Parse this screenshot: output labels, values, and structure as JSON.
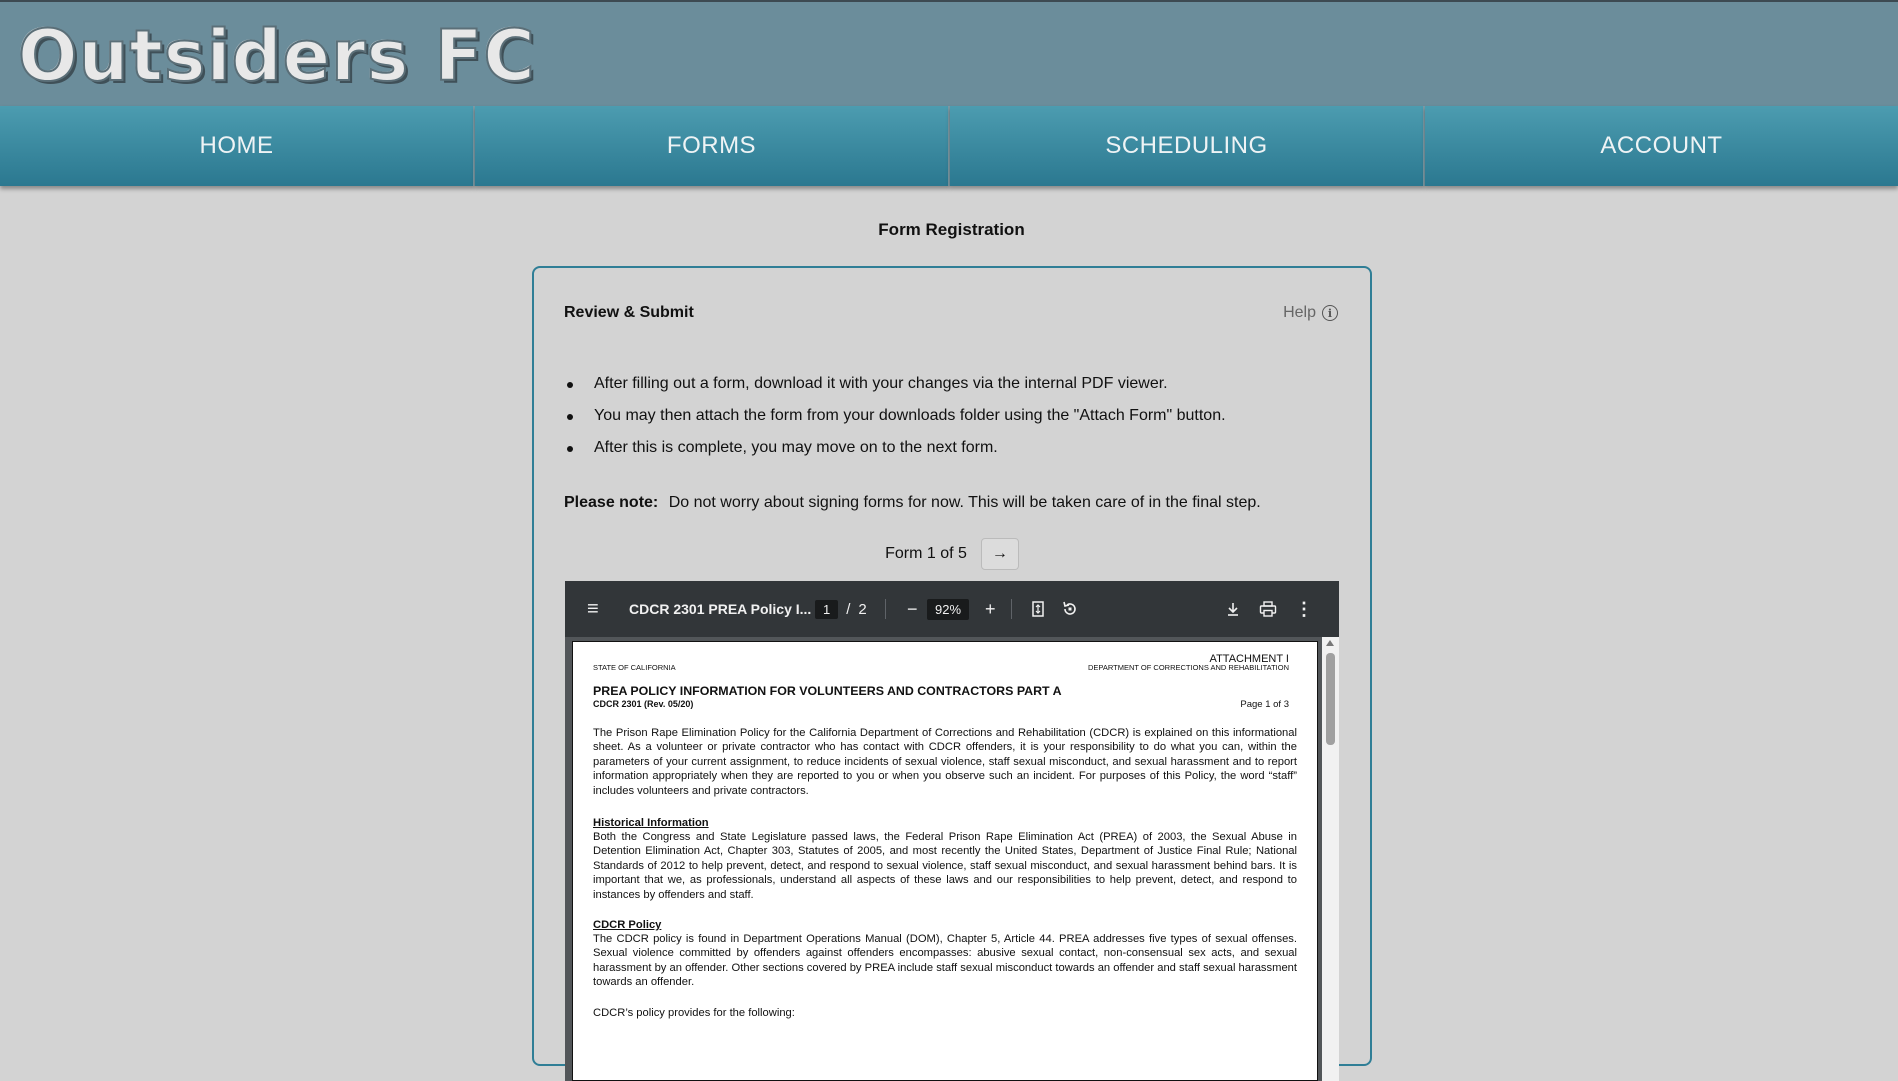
{
  "header": {
    "logo_text": "Outsiders FC",
    "background": "#6b8d9b"
  },
  "nav": {
    "items": [
      {
        "label": "HOME"
      },
      {
        "label": "FORMS"
      },
      {
        "label": "SCHEDULING"
      },
      {
        "label": "ACCOUNT"
      }
    ],
    "accent": "#2b7890"
  },
  "page": {
    "title": "Form Registration"
  },
  "card": {
    "title": "Review & Submit",
    "help_label": "Help",
    "help_icon": "info-icon",
    "bullets": [
      "After filling out a form, download it with your changes via the internal PDF viewer.",
      "You may then attach the form from your downloads folder using the \"Attach Form\" button.",
      "After this is complete, you may move on to the next form."
    ],
    "note_label": "Please note:",
    "note_text": "Do not worry about signing forms for now. This will be taken care of in the final step.",
    "pager_text": "Form 1 of 5",
    "next_icon": "→"
  },
  "pdf_viewer": {
    "menu_icon": "≡",
    "filename": "CDCR 2301 PREA Policy I...",
    "current_page": "1",
    "page_separator": "/",
    "total_pages": "2",
    "zoom_out_icon": "−",
    "zoom": "92%",
    "zoom_in_icon": "+",
    "download_icon": "download-icon",
    "print_icon": "print-icon",
    "more_icon": "⋮",
    "document": {
      "attachment": "ATTACHMENT I",
      "state": "STATE OF CALIFORNIA",
      "department": "DEPARTMENT OF CORRECTIONS AND REHABILITATION",
      "title": "PREA POLICY INFORMATION FOR VOLUNTEERS AND CONTRACTORS PART A",
      "form_no": "CDCR 2301 (Rev. 05/20)",
      "page_label": "Page 1 of 3",
      "intro": "The Prison Rape Elimination Policy for the California Department of Corrections and Rehabilitation (CDCR) is explained on this informational sheet. As a volunteer or private contractor who has contact with CDCR offenders, it is your responsibility to do what you can, within the parameters of your current assignment, to reduce incidents of sexual violence, staff sexual misconduct, and sexual harassment and to report information appropriately when they are reported to you or when you observe such an incident. For purposes of this Policy, the word “staff” includes volunteers and private contractors.",
      "section1_heading": "Historical Information",
      "section1_text": "Both the Congress and State Legislature passed laws, the Federal Prison Rape Elimination Act (PREA) of 2003, the Sexual Abuse in Detention Elimination Act, Chapter 303, Statutes of 2005, and most recently the United States, Department of Justice Final Rule; National Standards of 2012 to help prevent, detect, and respond to sexual violence, staff sexual misconduct, and sexual harassment behind bars. It is important that we, as professionals, understand all aspects of these laws and our responsibilities to help prevent, detect, and respond to instances by offenders and staff.",
      "section2_heading": "CDCR Policy",
      "section2_text": "The CDCR policy is found in Department Operations Manual (DOM), Chapter 5, Article 44. PREA addresses five types of sexual offenses. Sexual violence committed by offenders against offenders encompasses: abusive sexual contact, non-consensual sex acts, and sexual harassment by an offender. Other sections covered by PREA include staff sexual misconduct towards an offender and staff sexual harassment towards an offender.",
      "provides_text": "CDCR’s policy provides for the following:"
    }
  }
}
